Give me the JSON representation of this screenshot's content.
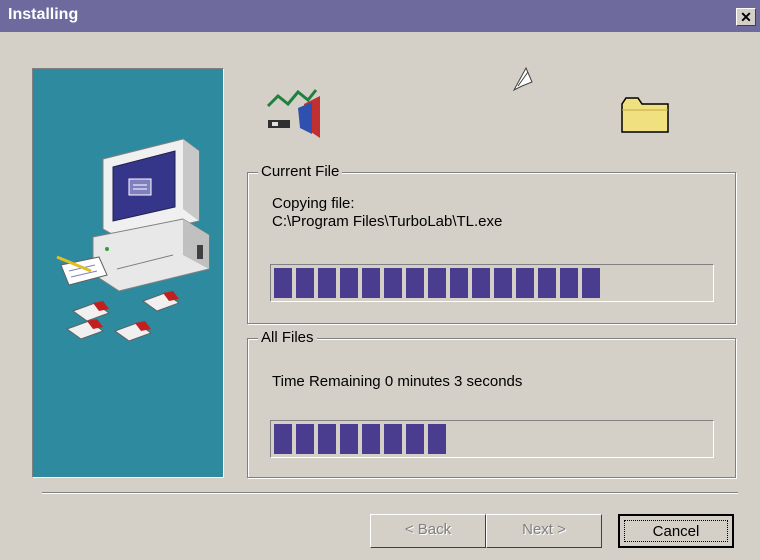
{
  "window": {
    "title": "Installing",
    "close_glyph": "✕"
  },
  "icons": [
    "computer-disks-illustration",
    "turbolab-app-icon",
    "flying-paper-icon",
    "folder-icon"
  ],
  "current_file": {
    "label": "Current File",
    "line1": "Copying file:",
    "line2": "C:\\Program Files\\TurboLab\\TL.exe",
    "progress": 0.75
  },
  "all_files": {
    "label": "All Files",
    "status": "Time Remaining 0 minutes 3 seconds",
    "progress": 0.4
  },
  "buttons": {
    "back": "< Back",
    "next": "Next >",
    "cancel": "Cancel"
  },
  "colors": {
    "titlebar": "#6e6a9e",
    "progress": "#4a3d8f",
    "side_panel": "#2e8b9f",
    "dialog": "#d4d0c8"
  }
}
